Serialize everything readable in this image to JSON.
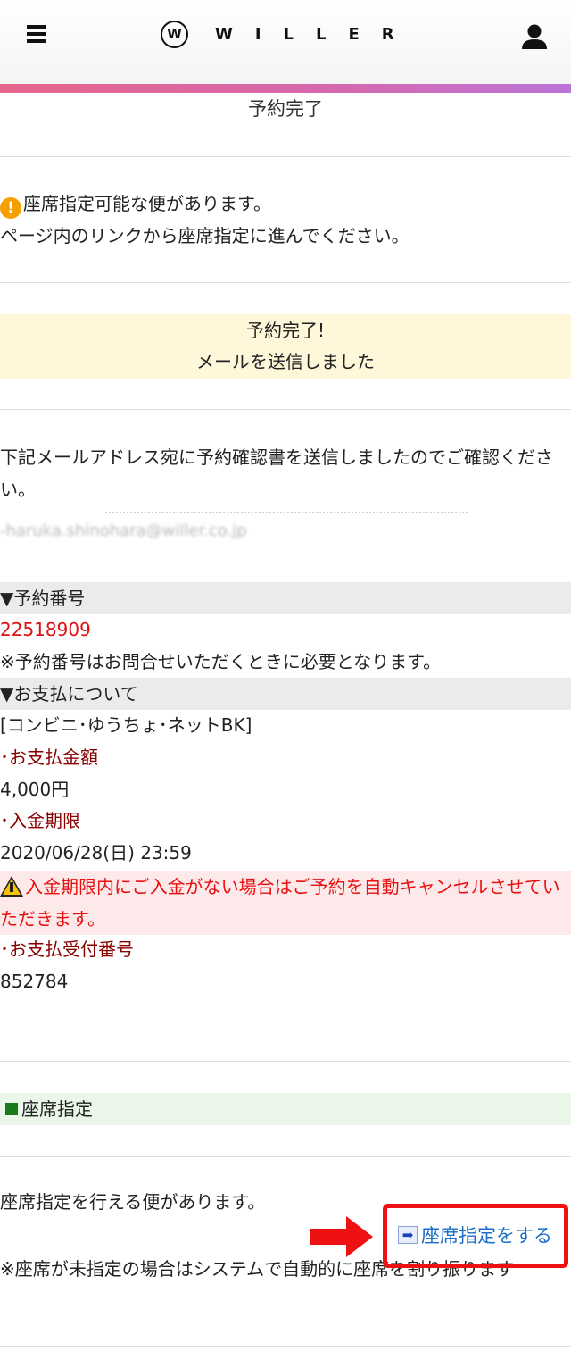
{
  "header": {
    "logo_mark": "W",
    "logo_text": "WILLER"
  },
  "page_title": "予約完了",
  "notice": {
    "line1": "座席指定可能な便があります。",
    "line2": "ページ内のリンクから座席指定に進んでください。"
  },
  "complete_box": {
    "line1": "予約完了!",
    "line2": "メールを送信しました"
  },
  "mail_sent": {
    "message": "下記メールアドレス宛に予約確認書を送信しましたのでご確認ください。",
    "email": "-haruka.shinohara@willer.co.jp"
  },
  "reservation": {
    "heading": "▼予約番号",
    "number": "22518909",
    "note": "※予約番号はお問合せいただくときに必要となります。"
  },
  "payment": {
    "heading": "▼お支払について",
    "method": "[コンビニ･ゆうちょ･ネットBK]",
    "amount_label": "･お支払金額",
    "amount": "4,000円",
    "deadline_label": "･入金期限",
    "deadline": "2020/06/28(日) 23:59",
    "warning": "入金期限内にご入金がない場合はご予約を自動キャンセルさせていただきます。",
    "receipt_label": "･お支払受付番号",
    "receipt_number": "852784"
  },
  "seat": {
    "heading": "座席指定",
    "available_text": "座席指定を行える便があります。",
    "link_label": "座席指定をする",
    "note": "※座席が未指定の場合はシステムで自動的に座席を割り振ります"
  },
  "colors": {
    "accent_stripe": "#e7668c",
    "reservation_red": "#e01010",
    "label_dark_red": "#8a0000",
    "link_blue": "#1b6ec8",
    "highlight_red": "#ee1111"
  },
  "icons": [
    "menu-icon",
    "willer-logo",
    "user-icon",
    "exclamation-icon",
    "warning-icon",
    "arrow-right-icon",
    "green-square-icon",
    "red-arrow-icon"
  ]
}
